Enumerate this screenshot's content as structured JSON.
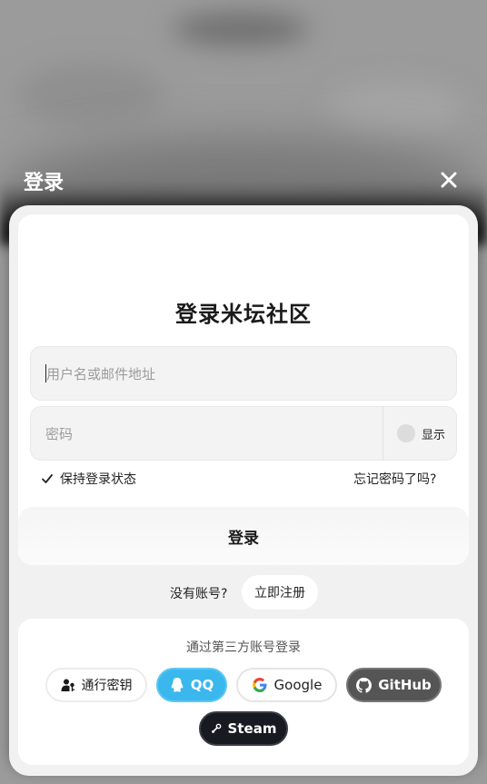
{
  "modal": {
    "title": "登录",
    "close_icon": "close-icon"
  },
  "form": {
    "heading": "登录米坛社区",
    "username_placeholder": "用户名或邮件地址",
    "password_placeholder": "密码",
    "show_password_label": "显示",
    "remember_label": "保持登录状态",
    "remember_checked": true,
    "forgot_label": "忘记密码了吗?",
    "submit_label": "登录"
  },
  "register": {
    "prompt": "没有账号?",
    "button_label": "立即注册"
  },
  "third_party": {
    "title": "通过第三方账号登录",
    "providers": [
      {
        "label": "通行密钥",
        "icon": "passkey-icon",
        "color": "#ffffff"
      },
      {
        "label": "QQ",
        "icon": "qq-icon",
        "color": "#3ab8ee"
      },
      {
        "label": "Google",
        "icon": "google-icon",
        "color": "#ffffff"
      },
      {
        "label": "GitHub",
        "icon": "github-icon",
        "color": "#555555"
      },
      {
        "label": "Steam",
        "icon": "steam-icon",
        "color": "#171a21"
      }
    ]
  }
}
